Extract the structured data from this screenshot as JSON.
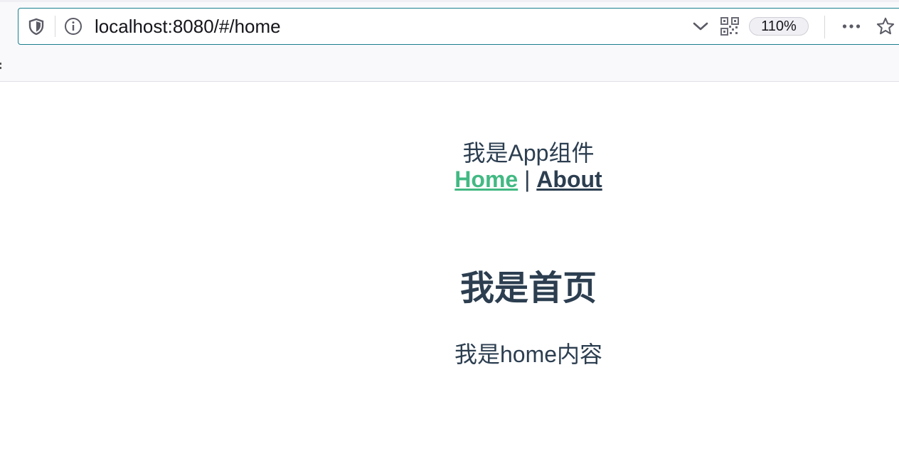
{
  "browser": {
    "url": "localhost:8080/#/home",
    "zoom_level": "110%",
    "icons": [
      "shield-icon",
      "info-icon",
      "chevron-down-icon",
      "qr-code-icon",
      "more-icon",
      "star-icon"
    ]
  },
  "app": {
    "title": "我是App组件",
    "nav": {
      "home_label": "Home",
      "separator": "|",
      "about_label": "About",
      "active": "Home"
    }
  },
  "page": {
    "heading": "我是首页",
    "text": "我是home内容"
  },
  "colors": {
    "text": "#2c3e50",
    "active_link": "#42b983",
    "urlbar_focus": "#1a7f8e"
  }
}
